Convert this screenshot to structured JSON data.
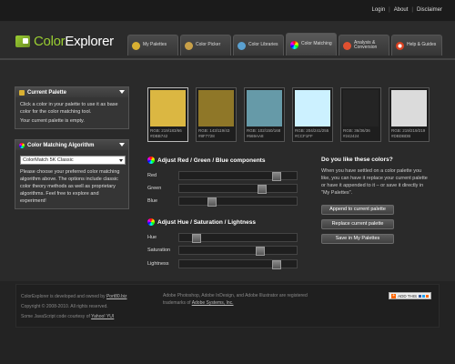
{
  "top_links": [
    "Login",
    "About",
    "Disclaimer"
  ],
  "brand": {
    "part1": "Color",
    "part2": "Explorer"
  },
  "tabs": [
    {
      "label": "My Palettes",
      "icon": "palette-icon",
      "color": "#d9b032"
    },
    {
      "label": "Color Picker",
      "icon": "eyedropper-icon",
      "color": "#c8a048"
    },
    {
      "label": "Color Libraries",
      "icon": "library-icon",
      "color": "#5aa0d0"
    },
    {
      "label": "Color Matching",
      "icon": "color-wheel-icon",
      "color": "#e040a0"
    },
    {
      "label": "Analysis & Conversion",
      "icon": "analysis-icon",
      "color": "#e05030"
    },
    {
      "label": "Help & Guides",
      "icon": "help-ring-icon",
      "color": "#d84020"
    }
  ],
  "current_palette": {
    "title": "Current Palette",
    "text": "Click a color in your palette to use it as base color for the color matching tool.",
    "status": "Your current palette is empty."
  },
  "algorithm": {
    "title": "Color Matching Algorithm",
    "selected": "ColorMatch 5K Classic",
    "description": "Please choose your preferred color matching algorithm above. The options include classic color theory methods as well as proprietary algorithms. Feel free to explore and experiment!"
  },
  "swatches": [
    {
      "color": "#dbb742",
      "rgb": "RGB: 219/183/66",
      "hex": "#DBB742"
    },
    {
      "color": "#8f7728",
      "rgb": "RGB: 143/119/43",
      "hex": "#8F7728"
    },
    {
      "color": "#669aa8",
      "rgb": "RGB: 102/150/168",
      "hex": "#669AA8"
    },
    {
      "color": "#ccf1ff",
      "rgb": "RGB: 204/241/255",
      "hex": "#CCF1FF"
    },
    {
      "color": "#242424",
      "rgb": "RGB: 36/36/36",
      "hex": "#242424"
    },
    {
      "color": "#dbdbdb",
      "rgb": "RGB: 219/219/219",
      "hex": "#DBDBDB"
    }
  ],
  "rgb_section": {
    "title": "Adjust Red / Green / Blue components",
    "sliders": [
      {
        "label": "Red",
        "value": 0.86
      },
      {
        "label": "Green",
        "value": 0.72
      },
      {
        "label": "Blue",
        "value": 0.26
      }
    ]
  },
  "hsl_section": {
    "title": "Adjust Hue / Saturation / Lightness",
    "sliders": [
      {
        "label": "Hue",
        "value": 0.12
      },
      {
        "label": "Saturation",
        "value": 0.71
      },
      {
        "label": "Lightness",
        "value": 0.86
      }
    ]
  },
  "like": {
    "title": "Do you like these colors?",
    "text": "When you have settled on a color palette you like, you can have it replace your current palette or have it appended to it – or save it directly in \"My Palettes\".",
    "buttons": [
      "Append to current palette",
      "Replace current palette",
      "Save in My Palettes"
    ]
  },
  "footer": {
    "line1_pre": "ColorExplorer is developed and owned by ",
    "line1_link": "Port80.biz",
    "line2": "Copyright © 2008-2010. All rights reserved.",
    "line3_pre": "Some JavaScript code courtesy of ",
    "line3_link": "Yahoo! YUI",
    "trademark_pre": "Adobe Photoshop, Adobe InDesign, and Adobe Illustrator are registered trademarks of ",
    "trademark_link": "Adobe Systems, Inc.",
    "addthis": "ADD THIS"
  }
}
